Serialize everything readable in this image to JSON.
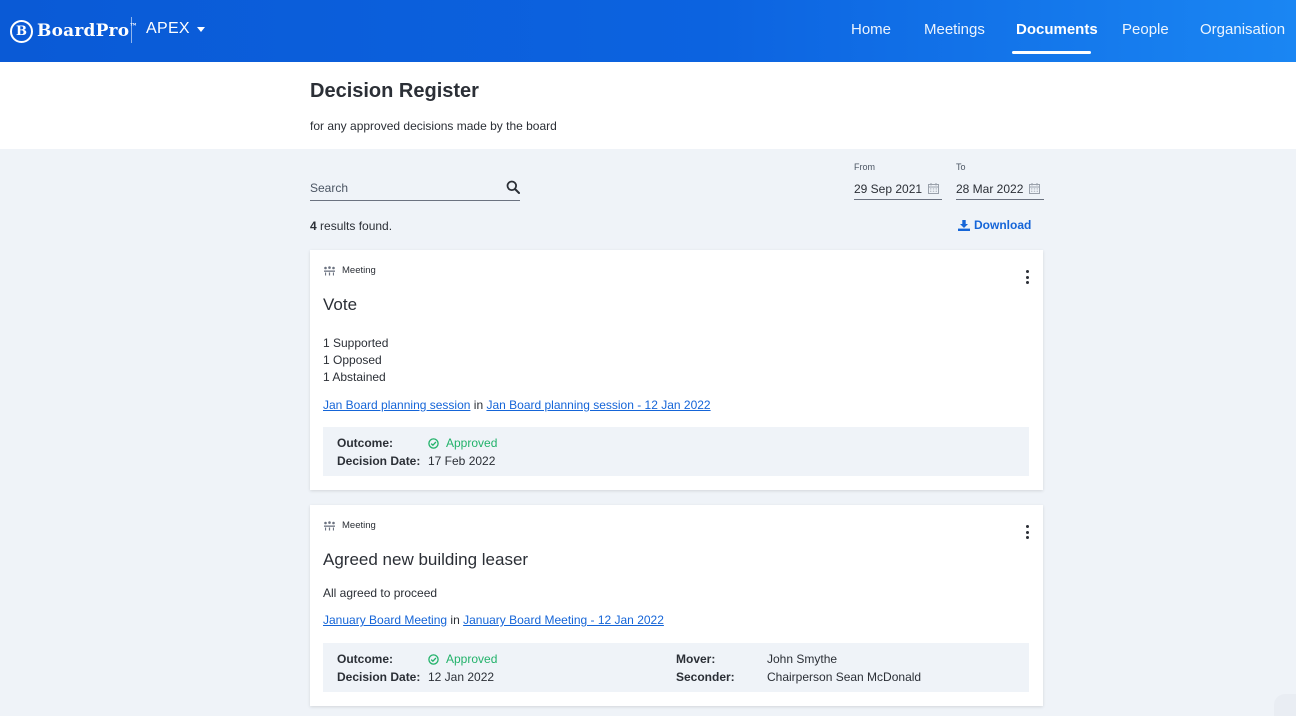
{
  "app": {
    "brand": "BoardPro",
    "brand_mark": "B",
    "tm": "™",
    "org": "APEX",
    "nav": [
      {
        "label": "Home",
        "active": false
      },
      {
        "label": "Meetings",
        "active": false
      },
      {
        "label": "Documents",
        "active": true
      },
      {
        "label": "People",
        "active": false
      },
      {
        "label": "Organisation",
        "active": false
      }
    ]
  },
  "page": {
    "title": "Decision Register",
    "subtitle": "for any approved decisions made by the board"
  },
  "filters": {
    "search_placeholder": "Search",
    "from_label": "From",
    "from_value": "29 Sep 2021",
    "to_label": "To",
    "to_value": "28 Mar 2022"
  },
  "results": {
    "count": "4",
    "text": " results found.",
    "download_label": "Download"
  },
  "cards": [
    {
      "type": "Meeting",
      "title": "Vote",
      "body": [
        "1 Supported",
        "1 Opposed",
        "1 Abstained"
      ],
      "link1": "Jan Board planning session",
      "in": " in ",
      "link2": "Jan Board planning session - 12 Jan 2022",
      "outcome_label": "Outcome:",
      "outcome_value": "Approved",
      "date_label": "Decision Date:",
      "date_value": "17 Feb 2022"
    },
    {
      "type": "Meeting",
      "title": "Agreed new building leaser",
      "body": [
        "All agreed to proceed"
      ],
      "link1": "January Board Meeting",
      "in": " in ",
      "link2": "January Board Meeting - 12 Jan 2022",
      "outcome_label": "Outcome:",
      "outcome_value": "Approved",
      "date_label": "Decision Date:",
      "date_value": "12 Jan 2022",
      "mover_label": "Mover:",
      "mover_value": "John Smythe",
      "seconder_label": "Seconder:",
      "seconder_value": "Chairperson Sean McDonald"
    }
  ],
  "colors": {
    "nav_start": "#0a5ad6",
    "nav_end": "#1a86f3",
    "link": "#1565d8",
    "approved": "#22b26a",
    "page_bg": "#eff3f8"
  }
}
